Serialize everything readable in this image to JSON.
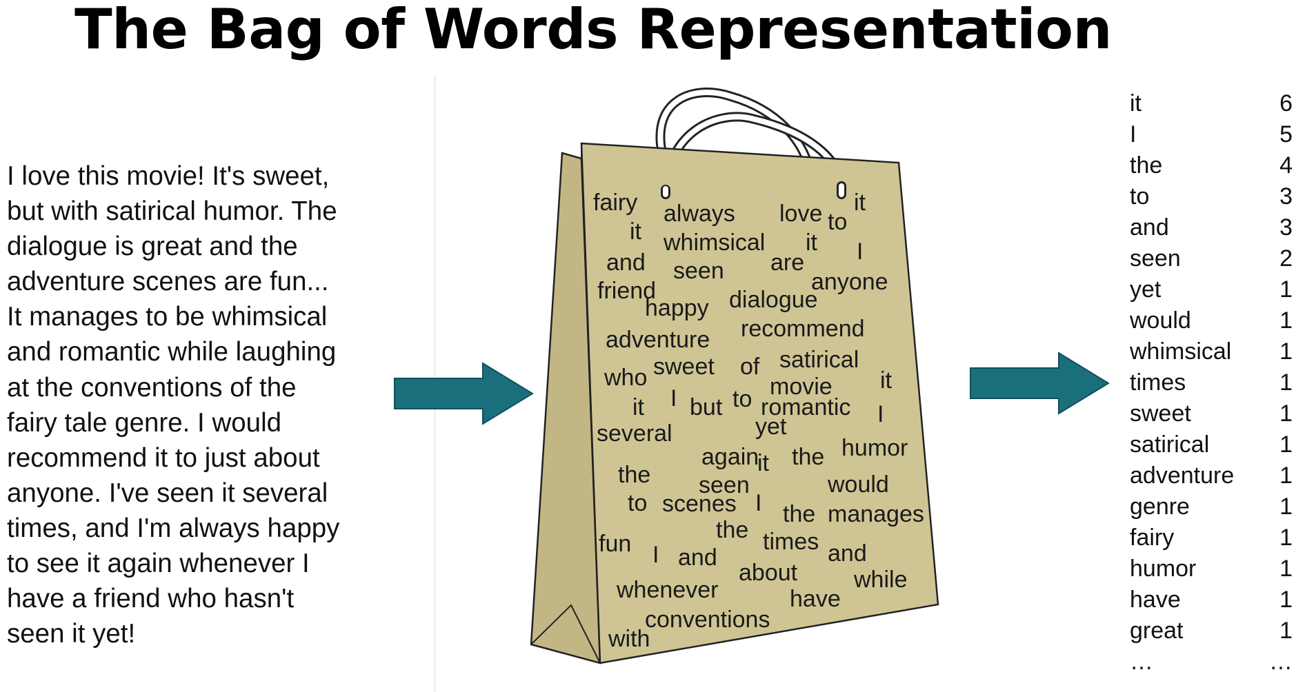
{
  "title": "The Bag of Words Representation",
  "review_lines": [
    "I love this movie! It's sweet,",
    "but with satirical humor. The",
    "dialogue is great and the",
    "adventure scenes are fun...",
    "It manages to be whimsical",
    "and romantic while laughing",
    "at the conventions of the",
    "fairy tale genre. I would",
    "recommend it to just about",
    "anyone. I've seen it several",
    "times, and I'm always happy",
    "to see it again whenever I",
    "have a friend who hasn't",
    "seen it yet!"
  ],
  "bag_words": [
    "fairy",
    "always",
    "love",
    "to",
    "it",
    "it",
    "whimsical",
    "it",
    "I",
    "and",
    "seen",
    "are",
    "anyone",
    "friend",
    "happy",
    "dialogue",
    "adventure",
    "recommend",
    "who",
    "sweet",
    "of",
    "satirical",
    "it",
    "movie",
    "I",
    "but",
    "to",
    "romantic",
    "I",
    "it",
    "several",
    "yet",
    "again",
    "it",
    "the",
    "humor",
    "the",
    "seen",
    "would",
    "to",
    "scenes",
    "I",
    "the",
    "manages",
    "fun",
    "I",
    "the",
    "and",
    "times",
    "and",
    "about",
    "while",
    "whenever",
    "have",
    "conventions",
    "with"
  ],
  "word_counts": [
    {
      "word": "it",
      "count": "6"
    },
    {
      "word": "I",
      "count": "5"
    },
    {
      "word": "the",
      "count": "4"
    },
    {
      "word": "to",
      "count": "3"
    },
    {
      "word": "and",
      "count": "3"
    },
    {
      "word": "seen",
      "count": "2"
    },
    {
      "word": "yet",
      "count": "1"
    },
    {
      "word": "would",
      "count": "1"
    },
    {
      "word": "whimsical",
      "count": "1"
    },
    {
      "word": "times",
      "count": "1"
    },
    {
      "word": "sweet",
      "count": "1"
    },
    {
      "word": "satirical",
      "count": "1"
    },
    {
      "word": "adventure",
      "count": "1"
    },
    {
      "word": "genre",
      "count": "1"
    },
    {
      "word": "fairy",
      "count": "1"
    },
    {
      "word": "humor",
      "count": "1"
    },
    {
      "word": "have",
      "count": "1"
    },
    {
      "word": "great",
      "count": "1"
    },
    {
      "word": "…",
      "count": "…"
    }
  ],
  "colors": {
    "arrow": "#1b6f7d",
    "arrow_outline": "#0f4f5a",
    "bag_fill": "#cfc594",
    "bag_side": "#c2b784",
    "bag_outline": "#222222"
  },
  "icons": {
    "left_arrow": "arrow-right-icon",
    "right_arrow": "arrow-right-icon",
    "bag": "shopping-bag-icon"
  }
}
